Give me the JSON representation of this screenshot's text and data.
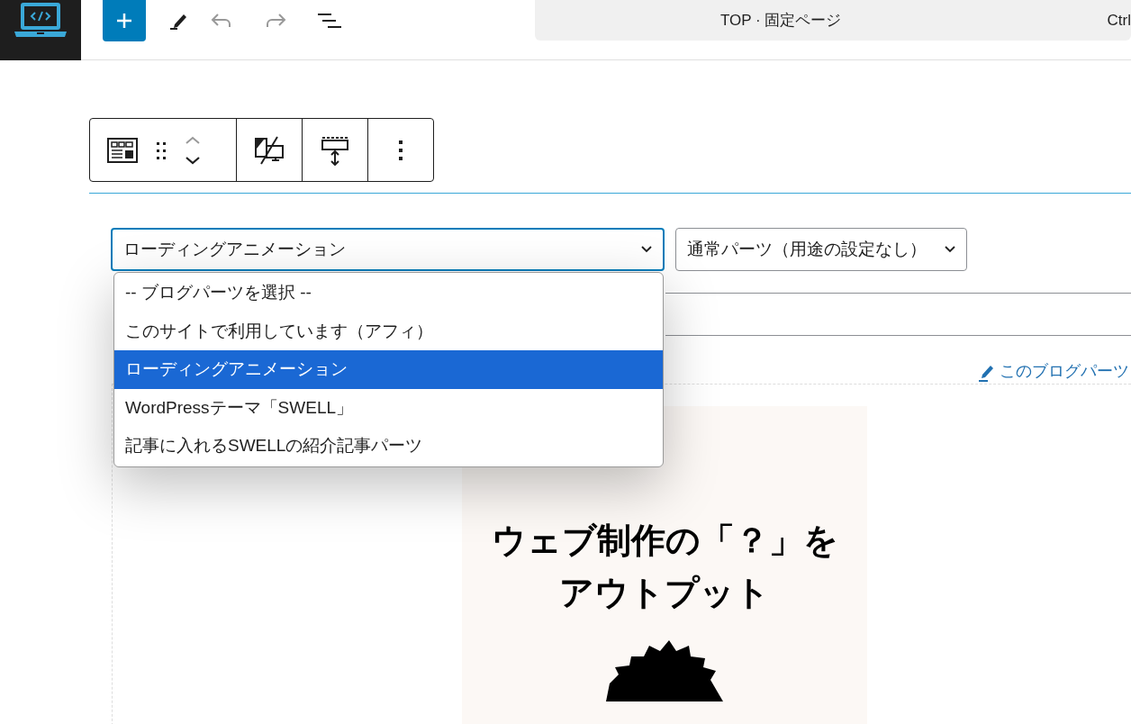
{
  "header": {
    "command_title": "TOP · 固定ページ",
    "shortcut": "Ctrl"
  },
  "block_select": {
    "value": "ローディングアニメーション",
    "expanded": true
  },
  "usage_select": {
    "value": "通常パーツ（用途の設定なし）"
  },
  "dropdown_options": [
    {
      "label": "-- ブログパーツを選択 --",
      "selected": false
    },
    {
      "label": "このサイトで利用しています（アフィ）",
      "selected": false
    },
    {
      "label": "ローディングアニメーション",
      "selected": true
    },
    {
      "label": "WordPressテーマ「SWELL」",
      "selected": false
    },
    {
      "label": "記事に入れるSWELLの紹介記事パーツ",
      "selected": false
    }
  ],
  "edit_link": "このブログパーツ",
  "banner": {
    "line_1": "ウェブ制作の「？」を",
    "line_2": "アウトプット"
  }
}
